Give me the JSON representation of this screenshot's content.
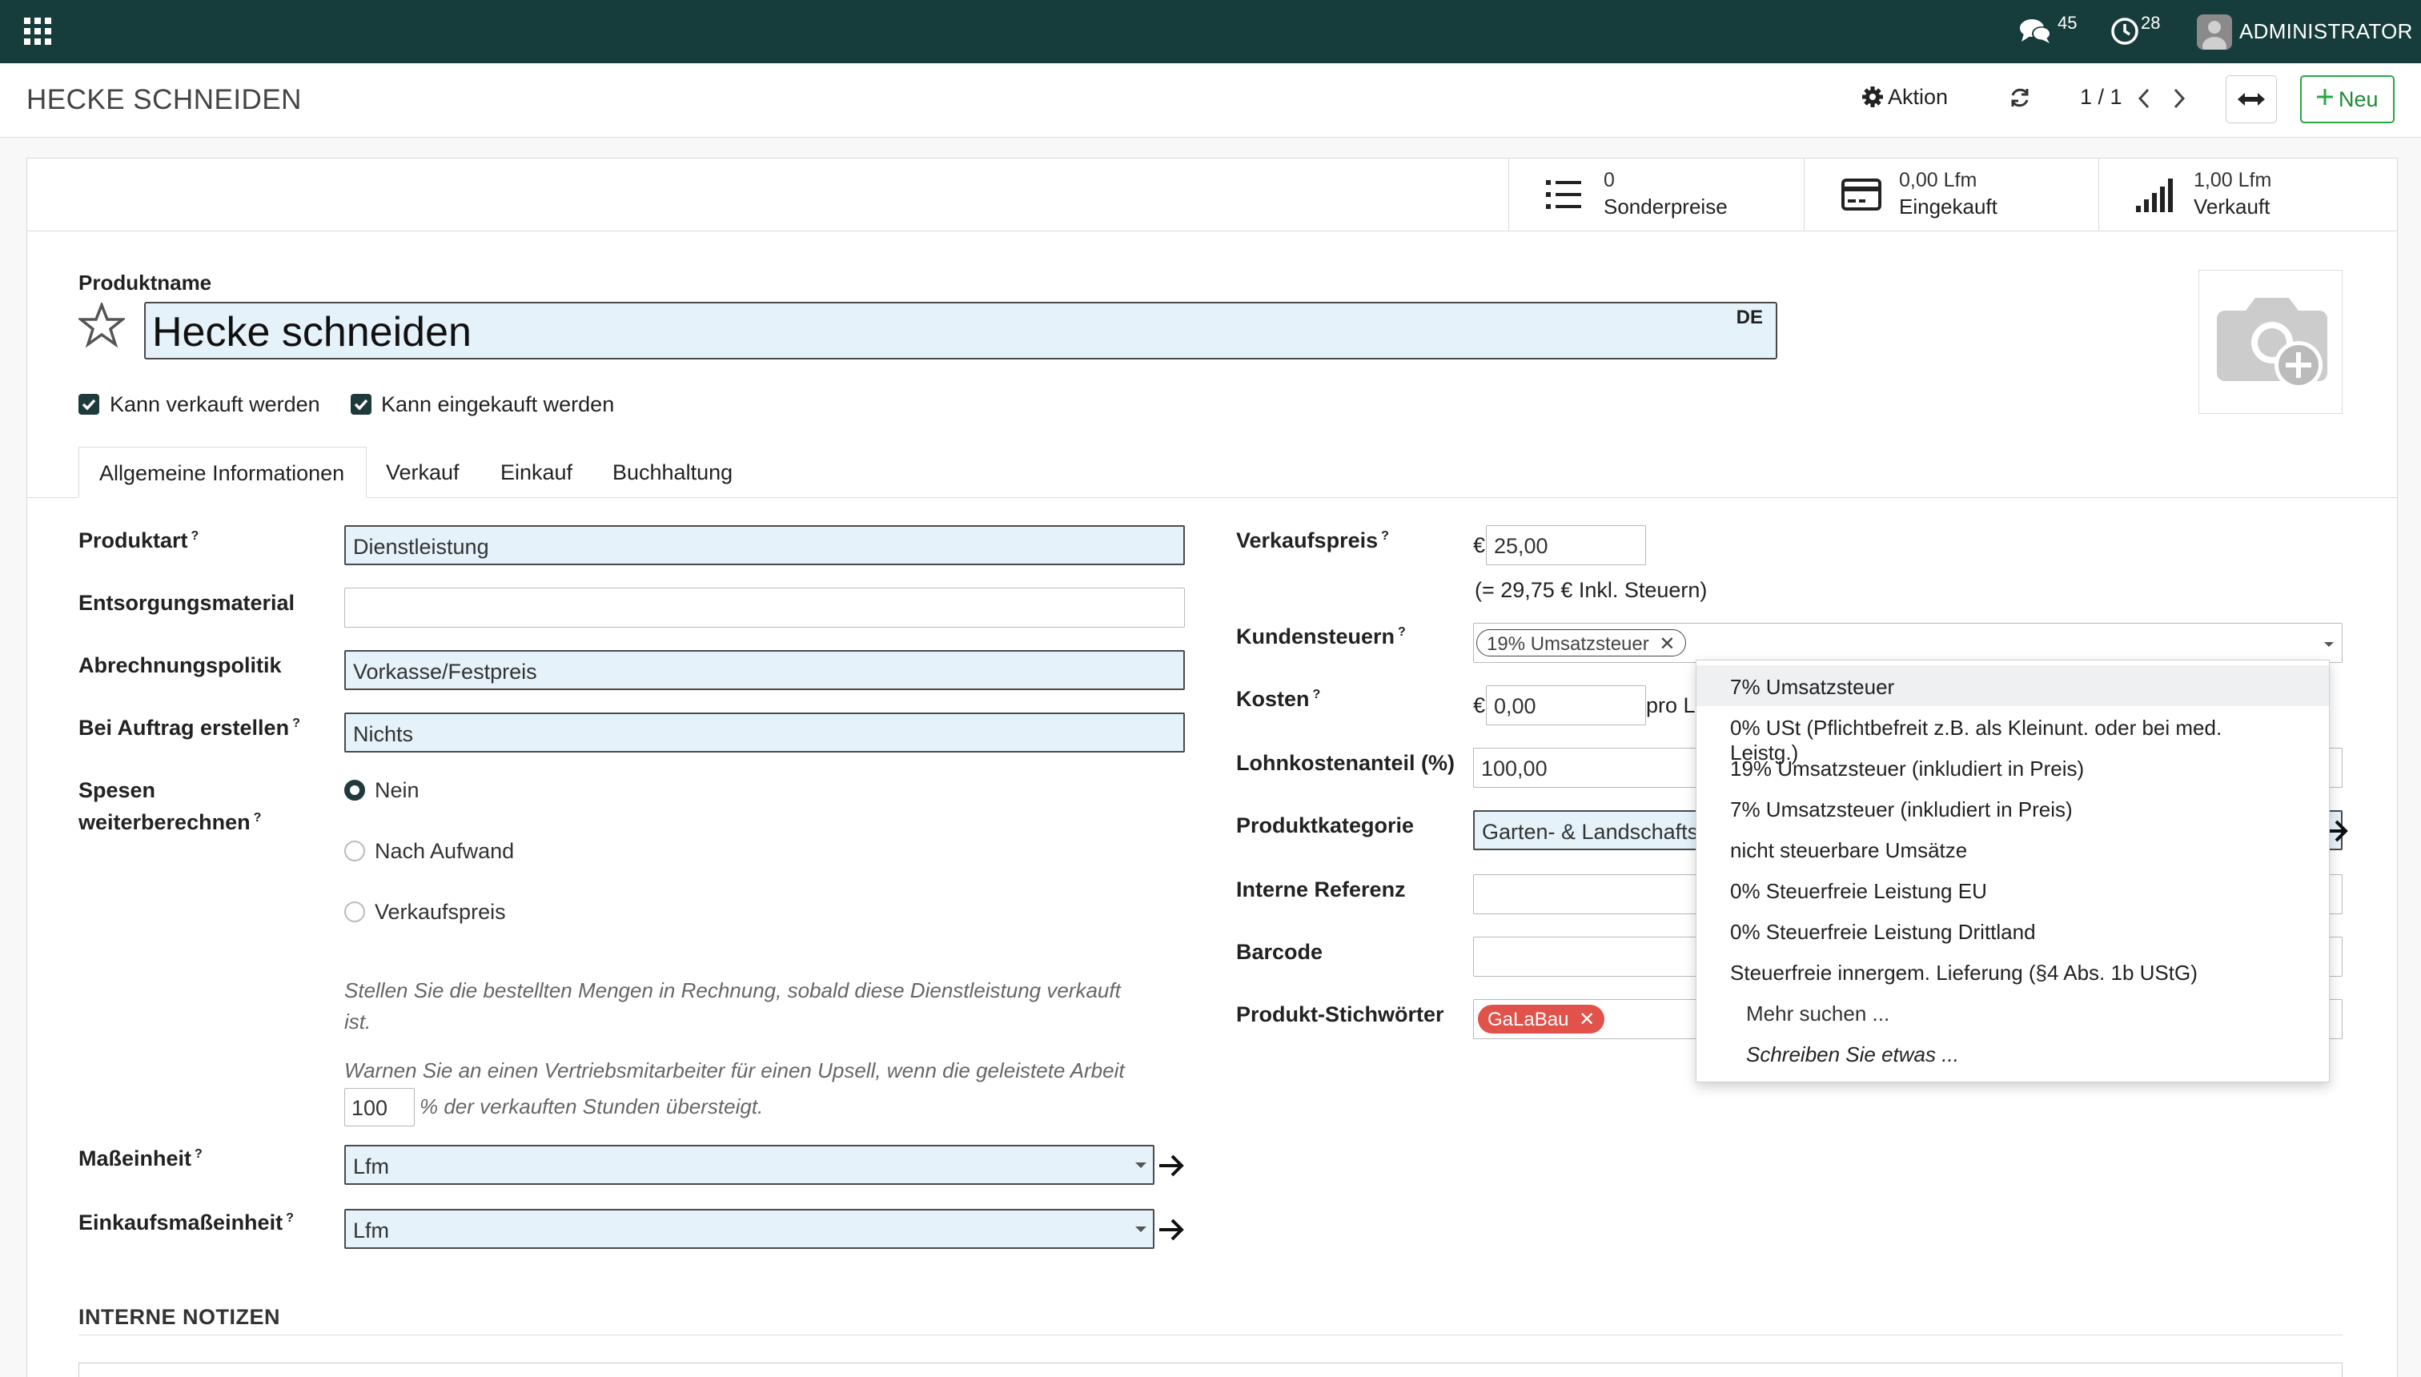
{
  "navbar": {
    "messages_count": "45",
    "activities_count": "28",
    "user_name": "ADMINISTRATOR"
  },
  "control_panel": {
    "title": "HECKE SCHNEIDEN",
    "action_label": "Aktion",
    "pager": "1 / 1",
    "new_label": "Neu"
  },
  "stats": [
    {
      "value": "0",
      "label": "Sonderpreise",
      "icon": "list-icon"
    },
    {
      "value": "0,00 Lfm",
      "label": "Eingekauft",
      "icon": "credit-card-icon"
    },
    {
      "value": "1,00 Lfm",
      "label": "Verkauft",
      "icon": "signal-icon"
    }
  ],
  "form": {
    "product_name_label": "Produktname",
    "product_name": "Hecke schneiden",
    "lang_badge": "DE",
    "can_be_sold_label": "Kann verkauft werden",
    "can_be_purchased_label": "Kann eingekauft werden",
    "tabs": [
      "Allgemeine Informationen",
      "Verkauf",
      "Einkauf",
      "Buchhaltung"
    ],
    "left": {
      "product_type_label": "Produktart",
      "product_type": "Dienstleistung",
      "disposal_label": "Entsorgungsmaterial",
      "disposal": "",
      "invoicing_label": "Abrechnungspolitik",
      "invoicing": "Vorkasse/Festpreis",
      "on_order_label": "Bei Auftrag erstellen",
      "on_order": "Nichts",
      "expenses_label_1": "Spesen",
      "expenses_label_2": "weiterberechnen",
      "radio_options": [
        "Nein",
        "Nach Aufwand",
        "Verkaufspreis"
      ],
      "hint_1": "Stellen Sie die bestellten Mengen in Rechnung, sobald diese Dienstleistung verkauft",
      "hint_1b": "ist.",
      "hint_2": "Warnen Sie an einen Vertriebsmitarbeiter für einen Upsell, wenn die geleistete Arbeit",
      "upsell_percent": "100",
      "hint_3": "% der verkauften Stunden übersteigt.",
      "uom_label": "Maßeinheit",
      "uom": "Lfm",
      "purchase_uom_label": "Einkaufsmaßeinheit",
      "purchase_uom": "Lfm"
    },
    "right": {
      "sale_price_label": "Verkaufspreis",
      "currency": "€",
      "sale_price": "25,00",
      "incl_taxes": "(= 29,75 € Inkl. Steuern)",
      "customer_taxes_label": "Kundensteuern",
      "customer_tax_tag": "19% Umsatzsteuer",
      "cost_label": "Kosten",
      "cost": "0,00",
      "cost_suffix": "pro L",
      "labor_label": "Lohnkostenanteil (%)",
      "labor": "100,00",
      "category_label": "Produktkategorie",
      "category": "Garten- & Landschafts",
      "ref_label": "Interne Referenz",
      "barcode_label": "Barcode",
      "tags_label": "Produkt-Stichwörter",
      "tag": "GaLaBau"
    },
    "internal_notes_label": "INTERNE NOTIZEN"
  },
  "tax_dropdown": {
    "options": [
      "7% Umsatzsteuer",
      "0% USt (Pflichtbefreit z.B. als Kleinunt. oder bei med. Leistg.)",
      "19% Umsatzsteuer (inkludiert in Preis)",
      "7% Umsatzsteuer (inkludiert in Preis)",
      "nicht steuerbare Umsätze",
      "0% Steuerfreie Leistung EU",
      "0% Steuerfreie Leistung Drittland",
      "Steuerfreie innergem. Lieferung (§4 Abs. 1b UStG)"
    ],
    "search_more": "Mehr suchen ...",
    "write_something": "Schreiben Sie etwas ..."
  },
  "colors": {
    "navbar": "#163d3b",
    "required_field": "#e6f2fa",
    "new_button": "#28a745",
    "tag_red": "#e0524a"
  }
}
